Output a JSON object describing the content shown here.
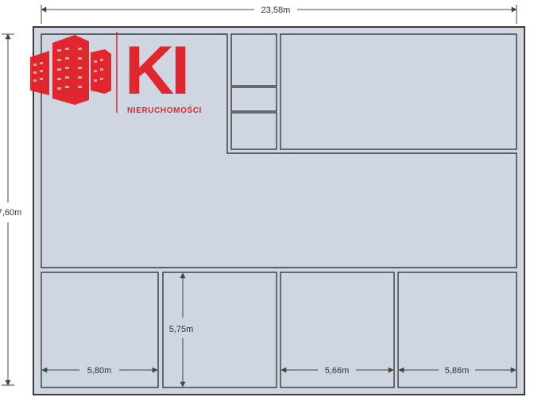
{
  "plan": {
    "colors": {
      "room_fill": "#cdd6e1",
      "room_stroke": "#3a3a3a",
      "dim_line": "#444444",
      "logo_red": "#e31e24"
    },
    "dimensions": {
      "top_width": "23,58m",
      "left_height": "7,60m",
      "room_a_width": "5,80m",
      "room_b_height": "5,75m",
      "room_c_width": "5,66m",
      "room_d_width": "5,86m"
    }
  },
  "logo": {
    "letters": "KI",
    "subtitle": "NIERUCHOMOŚCI",
    "icon": "buildings-icon"
  }
}
